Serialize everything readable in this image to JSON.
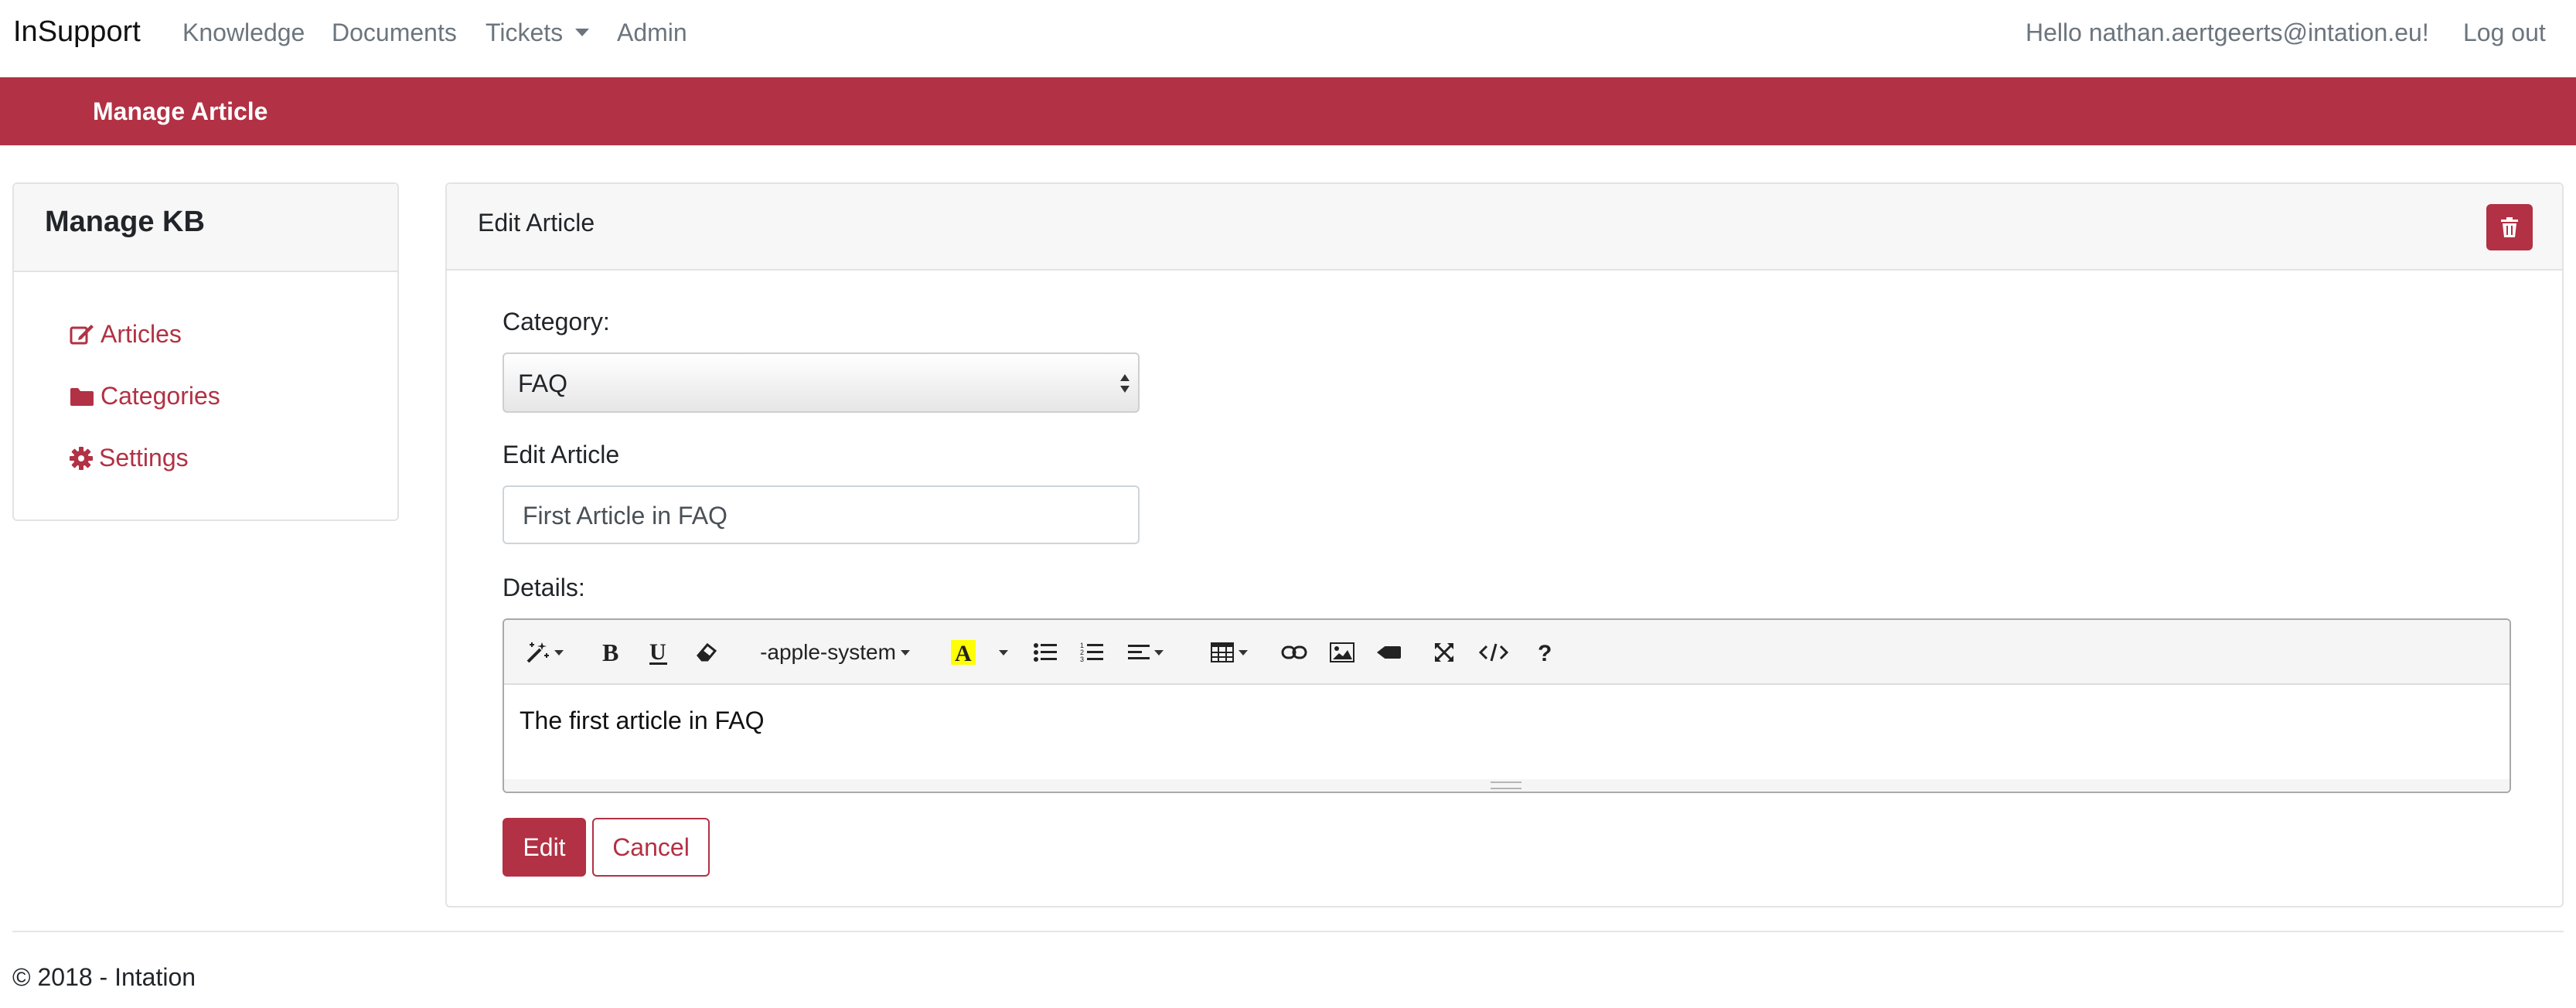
{
  "nav": {
    "brand": "InSupport",
    "links": [
      "Knowledge",
      "Documents",
      "Tickets",
      "Admin"
    ],
    "greeting": "Hello nathan.aertgeerts@intation.eu!",
    "logout": "Log out"
  },
  "banner": {
    "title": "Manage Article"
  },
  "sidebar": {
    "title": "Manage KB",
    "items": [
      {
        "label": "Articles",
        "icon": "edit-icon"
      },
      {
        "label": "Categories",
        "icon": "folder-icon"
      },
      {
        "label": "Settings",
        "icon": "gear-icon"
      }
    ]
  },
  "main": {
    "title": "Edit Article",
    "category_label": "Category:",
    "category_value": "FAQ",
    "article_label": "Edit Article",
    "article_value": "First Article in FAQ",
    "details_label": "Details:",
    "editor": {
      "font_name": "-apple-system",
      "content": "The first article in FAQ"
    },
    "edit_button": "Edit",
    "cancel_button": "Cancel"
  },
  "footer": {
    "text": "© 2018 - Intation"
  },
  "colors": {
    "accent": "#b23144",
    "nav_text": "#6c757d",
    "card_border": "#e3e3e3"
  }
}
